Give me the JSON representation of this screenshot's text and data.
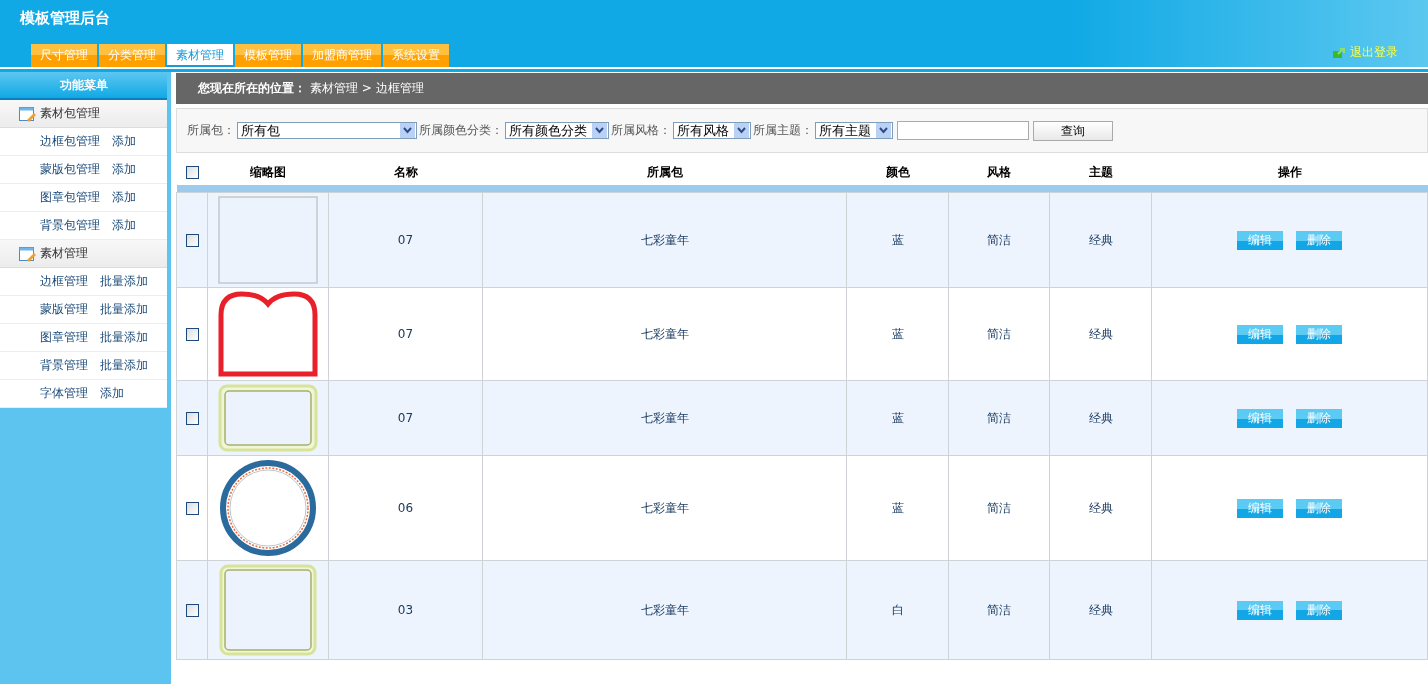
{
  "app_title": "模板管理后台",
  "tabs": [
    {
      "label": "尺寸管理",
      "selected": false
    },
    {
      "label": "分类管理",
      "selected": false
    },
    {
      "label": "素材管理",
      "selected": true
    },
    {
      "label": "模板管理",
      "selected": false
    },
    {
      "label": "加盟商管理",
      "selected": false
    },
    {
      "label": "系统设置",
      "selected": false
    }
  ],
  "logout": "退出登录",
  "sidebar": {
    "title": "功能菜单",
    "groups": [
      {
        "title": "素材包管理",
        "items": [
          {
            "label": "边框包管理",
            "action": "添加"
          },
          {
            "label": "蒙版包管理",
            "action": "添加"
          },
          {
            "label": "图章包管理",
            "action": "添加"
          },
          {
            "label": "背景包管理",
            "action": "添加"
          }
        ]
      },
      {
        "title": "素材管理",
        "items": [
          {
            "label": "边框管理",
            "action": "批量添加"
          },
          {
            "label": "蒙版管理",
            "action": "批量添加"
          },
          {
            "label": "图章管理",
            "action": "批量添加"
          },
          {
            "label": "背景管理",
            "action": "批量添加"
          },
          {
            "label": "字体管理",
            "action": "添加"
          }
        ]
      }
    ]
  },
  "breadcrumb": {
    "label": "您现在所在的位置：",
    "path": "素材管理 > 边框管理"
  },
  "filters": [
    {
      "label": "所属包：",
      "value": "所有包"
    },
    {
      "label": "所属颜色分类：",
      "value": "所有颜色分类"
    },
    {
      "label": "所属风格：",
      "value": "所有风格"
    },
    {
      "label": "所属主题：",
      "value": "所有主题"
    }
  ],
  "search_button": "查询",
  "table": {
    "columns": [
      "缩略图",
      "名称",
      "所属包",
      "颜色",
      "风格",
      "主题",
      "操作"
    ],
    "all_checked": false,
    "rows": [
      {
        "checked": false,
        "thumb": {
          "kind": "plain"
        },
        "name": "07",
        "pack": "七彩童年",
        "color_name": "蓝",
        "style": "简洁",
        "theme": "经典",
        "actions": [
          "编辑",
          "删除"
        ]
      },
      {
        "checked": false,
        "thumb": {
          "kind": "scalloped"
        },
        "name": "07",
        "pack": "七彩童年",
        "color_name": "蓝",
        "style": "简洁",
        "theme": "经典",
        "actions": [
          "编辑",
          "删除"
        ]
      },
      {
        "checked": false,
        "thumb": {
          "kind": "rounded"
        },
        "name": "07",
        "pack": "七彩童年",
        "color_name": "蓝",
        "style": "简洁",
        "theme": "经典",
        "actions": [
          "编辑",
          "删除"
        ]
      },
      {
        "checked": false,
        "thumb": {
          "kind": "circle"
        },
        "name": "06",
        "pack": "七彩童年",
        "color_name": "蓝",
        "style": "简洁",
        "theme": "经典",
        "actions": [
          "编辑",
          "删除"
        ]
      },
      {
        "checked": false,
        "thumb": {
          "kind": "rounded-tall"
        },
        "name": "03",
        "pack": "七彩童年",
        "color_name": "白",
        "style": "简洁",
        "theme": "经典",
        "actions": [
          "编辑",
          "删除"
        ]
      }
    ]
  }
}
